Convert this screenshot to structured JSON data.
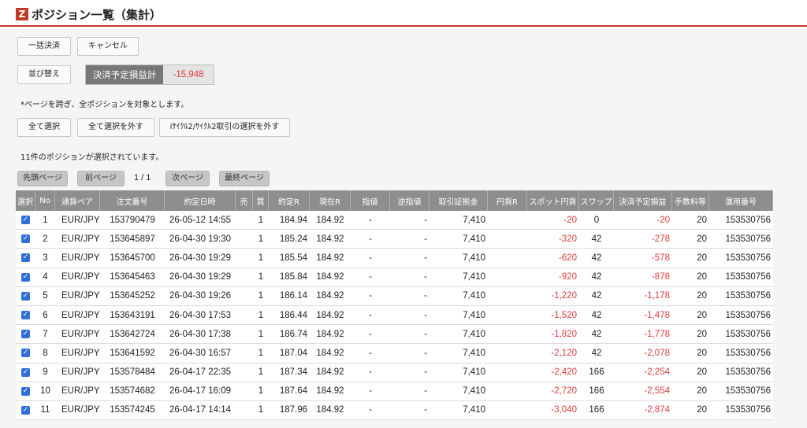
{
  "header": {
    "logo": "Z",
    "title": "ポジション一覧（集計）"
  },
  "colors": {
    "accent": "#c0392b",
    "negative": "#e03b3b",
    "checkbox": "#2f6fd6"
  },
  "buttons": {
    "bulk_settle": "一括決済",
    "cancel": "キャンセル",
    "sort": "並び替え",
    "select_all": "全て選択",
    "deselect_all": "全て選択を外す",
    "deselect_cycle": "iｻｲｸﾙ2/ｻｲｸﾙ2取引の選択を外す"
  },
  "pnl": {
    "label": "決済予定損益計",
    "value": "-15,948"
  },
  "notes": {
    "all_pages": "*ページを跨ぎ、全ポジションを対象とします。",
    "selected_count": "11件のポジションが選択されています。"
  },
  "pager": {
    "first": "先頭ページ",
    "prev": "前ページ",
    "current": "1 / 1",
    "next": "次ページ",
    "last": "最終ページ"
  },
  "table": {
    "headers": [
      "選択",
      "No",
      "通貨ペア",
      "注文番号",
      "約定日時",
      "売",
      "買",
      "約定R",
      "現在R",
      "指値",
      "逆指値",
      "取引証拠金",
      "円貨R",
      "スポット円貨",
      "スワップ",
      "決済予定損益",
      "手数料等",
      "運用番号"
    ],
    "rows": [
      [
        "1",
        "EUR/JPY",
        "153790479",
        "26-05-12 14:55",
        "",
        "1",
        "184.94",
        "184.92",
        "-",
        "-",
        "7,410",
        "",
        "-20",
        "0",
        "-20",
        "20",
        "153530756"
      ],
      [
        "2",
        "EUR/JPY",
        "153645897",
        "26-04-30 19:30",
        "",
        "1",
        "185.24",
        "184.92",
        "-",
        "-",
        "7,410",
        "",
        "-320",
        "42",
        "-278",
        "20",
        "153530756"
      ],
      [
        "3",
        "EUR/JPY",
        "153645700",
        "26-04-30 19:29",
        "",
        "1",
        "185.54",
        "184.92",
        "-",
        "-",
        "7,410",
        "",
        "-620",
        "42",
        "-578",
        "20",
        "153530756"
      ],
      [
        "4",
        "EUR/JPY",
        "153645463",
        "26-04-30 19:29",
        "",
        "1",
        "185.84",
        "184.92",
        "-",
        "-",
        "7,410",
        "",
        "-920",
        "42",
        "-878",
        "20",
        "153530756"
      ],
      [
        "5",
        "EUR/JPY",
        "153645252",
        "26-04-30 19:26",
        "",
        "1",
        "186.14",
        "184.92",
        "-",
        "-",
        "7,410",
        "",
        "-1,220",
        "42",
        "-1,178",
        "20",
        "153530756"
      ],
      [
        "6",
        "EUR/JPY",
        "153643191",
        "26-04-30 17:53",
        "",
        "1",
        "186.44",
        "184.92",
        "-",
        "-",
        "7,410",
        "",
        "-1,520",
        "42",
        "-1,478",
        "20",
        "153530756"
      ],
      [
        "7",
        "EUR/JPY",
        "153642724",
        "26-04-30 17:38",
        "",
        "1",
        "186.74",
        "184.92",
        "-",
        "-",
        "7,410",
        "",
        "-1,820",
        "42",
        "-1,778",
        "20",
        "153530756"
      ],
      [
        "8",
        "EUR/JPY",
        "153641592",
        "26-04-30 16:57",
        "",
        "1",
        "187.04",
        "184.92",
        "-",
        "-",
        "7,410",
        "",
        "-2,120",
        "42",
        "-2,078",
        "20",
        "153530756"
      ],
      [
        "9",
        "EUR/JPY",
        "153578484",
        "26-04-17 22:35",
        "",
        "1",
        "187.34",
        "184.92",
        "-",
        "-",
        "7,410",
        "",
        "-2,420",
        "166",
        "-2,254",
        "20",
        "153530756"
      ],
      [
        "10",
        "EUR/JPY",
        "153574682",
        "26-04-17 16:09",
        "",
        "1",
        "187.64",
        "184.92",
        "-",
        "-",
        "7,410",
        "",
        "-2,720",
        "166",
        "-2,554",
        "20",
        "153530756"
      ],
      [
        "11",
        "EUR/JPY",
        "153574245",
        "26-04-17 14:14",
        "",
        "1",
        "187.96",
        "184.92",
        "-",
        "-",
        "7,410",
        "",
        "-3,040",
        "166",
        "-2,874",
        "20",
        "153530756"
      ]
    ]
  }
}
